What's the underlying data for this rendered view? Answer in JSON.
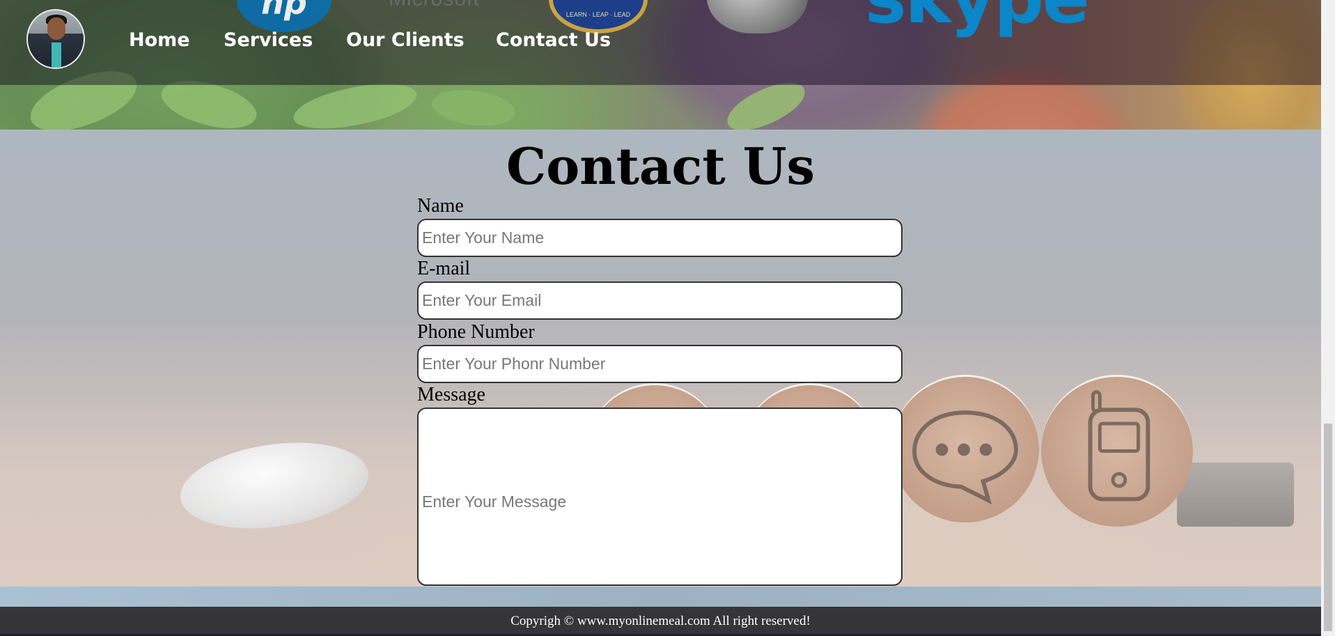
{
  "nav": {
    "items": [
      "Home",
      "Services",
      "Our Clients",
      "Contact Us"
    ]
  },
  "client_logos": {
    "microsoft": "Microsoft",
    "seal_motto": "LEARN · LEAP · LEAD",
    "skype": "skype"
  },
  "contact": {
    "title": "Contact Us",
    "name_label": "Name",
    "name_placeholder": "Enter Your Name",
    "email_label": "E-mail",
    "email_placeholder": "Enter Your Email",
    "phone_label": "Phone Number",
    "phone_placeholder": "Enter Your Phonr Number",
    "message_label": "Message",
    "message_placeholder": "Enter Your Message"
  },
  "footer": {
    "text": "Copyrigh © www.myonlinemeal.com All right reserved!"
  },
  "colors": {
    "navbar": "#464650",
    "footer": "#353537",
    "skype_blue": "#0a86c9"
  }
}
